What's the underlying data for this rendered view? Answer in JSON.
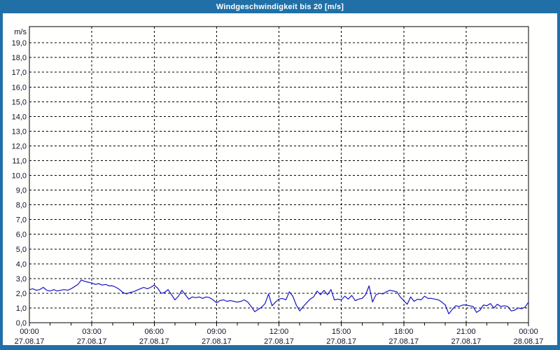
{
  "window": {
    "title": "Windgeschwindigkeit bis 20 [m/s]"
  },
  "colors": {
    "frame": "#2070a7",
    "plot_background": "#fffffd",
    "grid": "#000000",
    "axis": "#000000",
    "tick_text": "#10102a",
    "series_line": "#1414c8",
    "title_text": "#ffffff"
  },
  "chart_data": {
    "type": "line",
    "title": "Windgeschwindigkeit bis 20 [m/s]",
    "y_unit_label": "m/s",
    "ylim": [
      0,
      20.1
    ],
    "y_tick_step": 1.0,
    "y_tick_labels": [
      "0,0",
      "1,0",
      "2,0",
      "3,0",
      "4,0",
      "5,0",
      "6,0",
      "7,0",
      "8,0",
      "9,0",
      "10,0",
      "11,0",
      "12,0",
      "13,0",
      "14,0",
      "15,0",
      "16,0",
      "17,0",
      "18,0",
      "19,0"
    ],
    "grid_style": "dashed",
    "legend": "none",
    "x_axis": {
      "minor_tick_interval_minutes": 60,
      "major_tick_interval_minutes": 180,
      "major_ticks": [
        {
          "time": "00:00",
          "date": "27.08.17"
        },
        {
          "time": "03:00",
          "date": "27.08.17"
        },
        {
          "time": "06:00",
          "date": "27.08.17"
        },
        {
          "time": "09:00",
          "date": "27.08.17"
        },
        {
          "time": "12:00",
          "date": "27.08.17"
        },
        {
          "time": "15:00",
          "date": "27.08.17"
        },
        {
          "time": "18:00",
          "date": "27.08.17"
        },
        {
          "time": "21:00",
          "date": "27.08.17"
        },
        {
          "time": "00:00",
          "date": "28.08.17"
        }
      ]
    },
    "series": [
      {
        "name": "Windgeschwindigkeit",
        "unit": "m/s",
        "color": "#1414c8",
        "start": "27.08.17 00:00",
        "interval_minutes": 10,
        "values": [
          2.25,
          2.3,
          2.2,
          2.25,
          2.4,
          2.2,
          2.15,
          2.25,
          2.15,
          2.2,
          2.25,
          2.2,
          2.3,
          2.45,
          2.6,
          2.9,
          2.8,
          2.75,
          2.7,
          2.6,
          2.65,
          2.55,
          2.6,
          2.5,
          2.5,
          2.4,
          2.25,
          2.05,
          1.95,
          2.05,
          2.1,
          2.2,
          2.3,
          2.4,
          2.3,
          2.4,
          2.55,
          2.35,
          2.0,
          2.05,
          2.25,
          1.9,
          1.55,
          1.8,
          2.2,
          1.9,
          1.6,
          1.75,
          1.7,
          1.75,
          1.65,
          1.75,
          1.7,
          1.55,
          1.35,
          1.5,
          1.55,
          1.45,
          1.5,
          1.45,
          1.4,
          1.45,
          1.55,
          1.4,
          1.1,
          0.75,
          0.9,
          1.05,
          1.3,
          1.95,
          1.15,
          1.4,
          1.6,
          1.65,
          1.55,
          2.1,
          1.8,
          1.2,
          0.8,
          1.1,
          1.35,
          1.6,
          1.75,
          2.15,
          1.9,
          2.2,
          1.9,
          2.25,
          1.55,
          1.6,
          1.55,
          1.8,
          1.6,
          1.85,
          1.5,
          1.6,
          1.65,
          1.9,
          2.5,
          1.4,
          1.9,
          2.0,
          1.95,
          2.1,
          2.2,
          2.15,
          2.1,
          1.75,
          1.5,
          1.25,
          1.75,
          1.45,
          1.6,
          1.55,
          1.8,
          1.65,
          1.65,
          1.6,
          1.55,
          1.4,
          1.2,
          0.6,
          0.9,
          1.15,
          1.1,
          1.2,
          1.2,
          1.15,
          1.1,
          0.7,
          0.85,
          1.2,
          1.15,
          1.3,
          1.0,
          1.25,
          1.1,
          1.15,
          1.1,
          0.8,
          0.85,
          1.0,
          0.95,
          1.05,
          1.4
        ]
      }
    ]
  }
}
